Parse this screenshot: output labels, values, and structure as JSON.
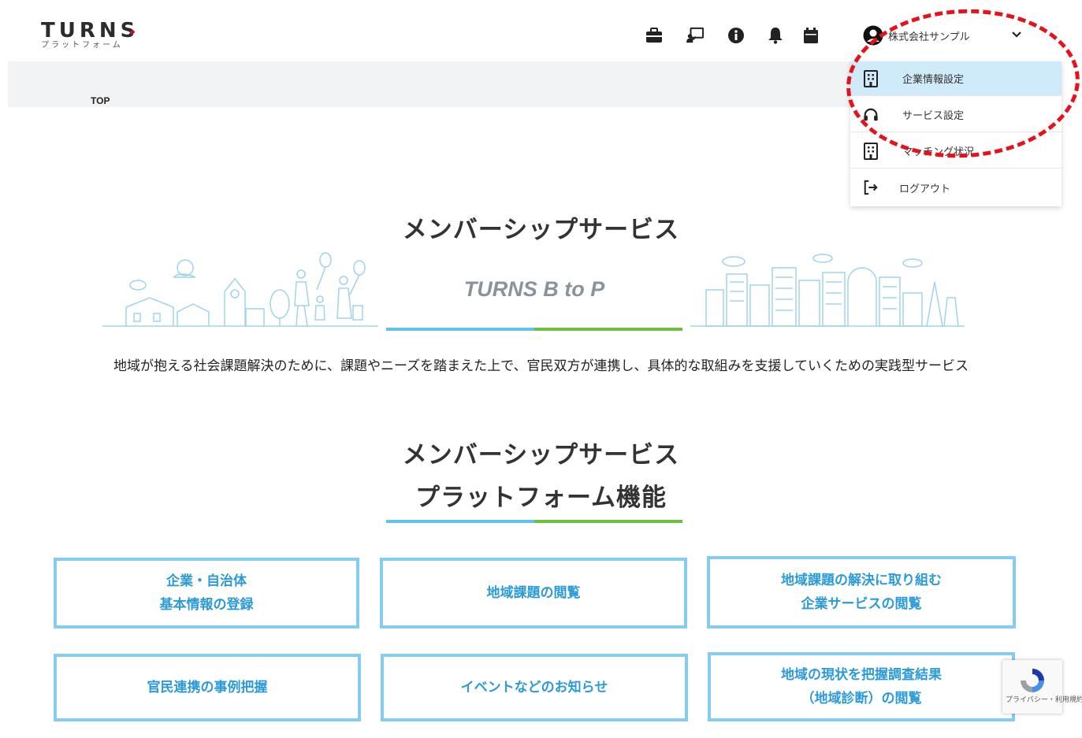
{
  "header": {
    "logo_text": "TURNS",
    "logo_sub": "プラットフォーム",
    "icons": [
      "briefcase-icon",
      "presentation-icon",
      "info-icon",
      "bell-icon",
      "calendar-icon"
    ],
    "user_name": "株式会社サンプル"
  },
  "breadcrumb": {
    "label": "TOP"
  },
  "menu": {
    "items": [
      {
        "label": "企業情報設定",
        "icon": "building-icon",
        "active": true
      },
      {
        "label": "サービス設定",
        "icon": "headset-icon"
      },
      {
        "label": "マッチング状況",
        "icon": "building-icon"
      },
      {
        "label": "ログアウト",
        "icon": "logout-icon"
      }
    ],
    "highlight_color": "#e8101a"
  },
  "section1": {
    "title": "メンバーシップサービス",
    "brand": "TURNS B to P",
    "description": "地域が抱える社会課題解決のために、課題やニーズを踏まえた上で、官民双方が連携し、具体的な取組みを支援していくための実践型サービス"
  },
  "section2": {
    "title_line1": "メンバーシップサービス",
    "title_line2": "プラットフォーム機能"
  },
  "cards": [
    {
      "label": "企業・自治体\n基本情報の登録"
    },
    {
      "label": "地域課題の閲覧"
    },
    {
      "label": "地域課題の解決に取り組む\n企業サービスの閲覧"
    },
    {
      "label": "官民連携の事例把握"
    },
    {
      "label": "イベントなどのお知らせ"
    },
    {
      "label": "地域の現状を把握調査結果\n（地域診断）の閲覧"
    }
  ],
  "recaptcha": {
    "text": "プライバシー・利用規約"
  },
  "colors": {
    "accent_blue": "#5ec4ee",
    "accent_green": "#6cbf3f",
    "card_text": "#2b9ad8",
    "card_border": "#86ccf0"
  }
}
